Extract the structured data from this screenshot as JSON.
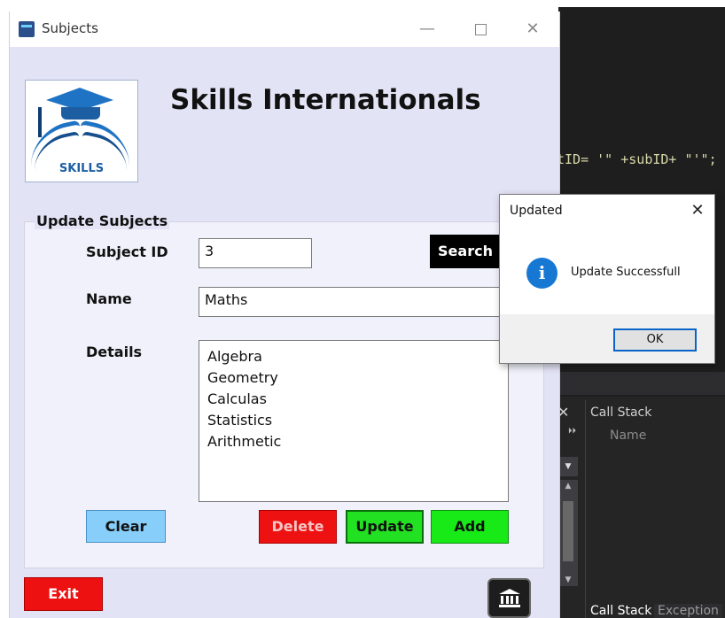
{
  "background_ide": {
    "code_fragment": "tID= '\" +subID+ \"'\";",
    "call_stack_title": "Call Stack",
    "call_stack_column": "Name",
    "bottom_tabs": [
      "Call Stack",
      "Exception"
    ]
  },
  "window": {
    "title": "Subjects",
    "app_title": "Skills Internationals",
    "logo_text": "SKILLS",
    "group_title": "Update Subjects",
    "fields": {
      "subject_id_label": "Subject ID",
      "subject_id_value": "3",
      "name_label": "Name",
      "name_value": "Maths",
      "details_label": "Details",
      "details_lines": [
        "Algebra",
        "Geometry",
        "Calculas",
        "Statistics",
        "Arithmetic"
      ]
    },
    "buttons": {
      "search": "Search",
      "clear": "Clear",
      "delete": "Delete",
      "update": "Update",
      "add": "Add",
      "exit": "Exit"
    },
    "icons": {
      "home": "bank-icon"
    }
  },
  "dialog": {
    "title": "Updated",
    "message": "Update Successfull",
    "ok": "OK"
  },
  "colors": {
    "window_bg": "#e3e3f6",
    "clear_btn": "#87cefa",
    "delete_btn": "#ee1111",
    "update_btn": "#22e022",
    "add_btn": "#18ea18",
    "info_icon": "#1778d4"
  }
}
